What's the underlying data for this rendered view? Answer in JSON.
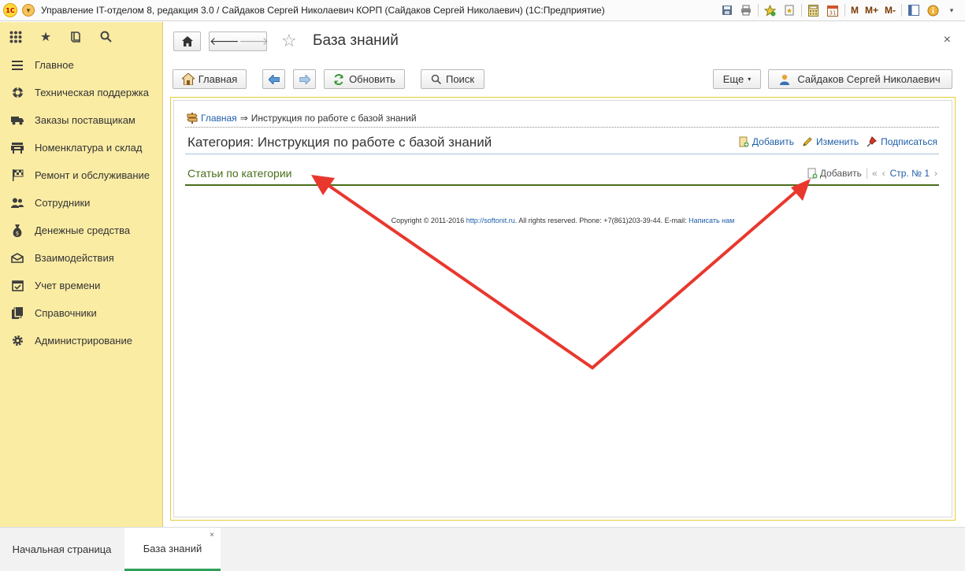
{
  "window": {
    "title": "Управление IT-отделом 8, редакция 3.0 / Сайдаков Сергей Николаевич КОРП (Сайдаков Сергей Николаевич)   (1С:Предприятие)",
    "logo_text": "1С",
    "tools": [
      "save-icon",
      "print-icon",
      "favorites-icon",
      "bookmark-icon",
      "calculator-icon",
      "calendar-icon"
    ],
    "mem_labels": [
      "M",
      "M+",
      "M-"
    ]
  },
  "sidebar": {
    "items": [
      {
        "label": "Главное",
        "icon": "menu-lines-icon"
      },
      {
        "label": "Техническая поддержка",
        "icon": "lifebuoy-icon"
      },
      {
        "label": "Заказы поставщикам",
        "icon": "truck-icon"
      },
      {
        "label": "Номенклатура и склад",
        "icon": "warehouse-icon"
      },
      {
        "label": "Ремонт и обслуживание",
        "icon": "checkered-flag-icon"
      },
      {
        "label": "Сотрудники",
        "icon": "people-icon"
      },
      {
        "label": "Денежные средства",
        "icon": "money-bag-icon"
      },
      {
        "label": "Взаимодействия",
        "icon": "envelope-icon"
      },
      {
        "label": "Учет времени",
        "icon": "calendar-check-icon"
      },
      {
        "label": "Справочники",
        "icon": "books-icon"
      },
      {
        "label": "Администрирование",
        "icon": "gear-icon"
      }
    ]
  },
  "header": {
    "title": "База знаний"
  },
  "cmdbar": {
    "home_label": "Главная",
    "refresh_label": "Обновить",
    "search_label": "Поиск",
    "more_label": "Еще",
    "user_label": "Сайдаков Сергей Николаевич"
  },
  "content": {
    "breadcrumb_link": "Главная",
    "breadcrumb_arrow": "⇒",
    "breadcrumb_current": "Инструкция по работе с базой знаний",
    "category_title": "Категория: Инструкция по работе с базой знаний",
    "actions": {
      "add": "Добавить",
      "edit": "Изменить",
      "subscribe": "Подписаться"
    },
    "section_title": "Статьи по категории",
    "section_add": "Добавить",
    "pager": {
      "first": "«",
      "prev": "‹",
      "page": "Стр. № 1",
      "next": "›"
    },
    "copyright": {
      "pre": "Copyright © 2011-2016 ",
      "site": "http://softonit.ru",
      "mid": ". All rights reserved. Phone: +7(861)203-39-44. E-mail: ",
      "mail": "Написать нам"
    }
  },
  "tabs": [
    {
      "label": "Начальная страница",
      "active": false
    },
    {
      "label": "База знаний",
      "active": true
    }
  ],
  "colors": {
    "sidebar_bg": "#fbeca4",
    "frame_border": "#e6cf33",
    "link": "#1f5ea8",
    "section_title": "#4a6e1a",
    "annotation_arrow": "#e8382e",
    "active_tab_underline": "#2fa05a"
  }
}
